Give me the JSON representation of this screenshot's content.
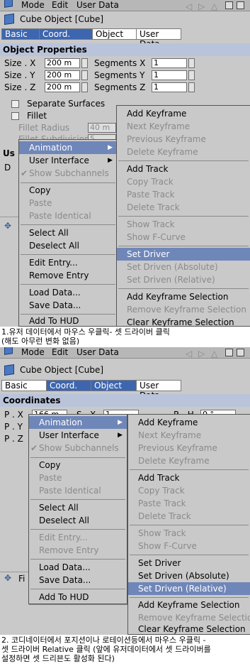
{
  "screen1": {
    "topbar": {
      "mode": "Mode",
      "edit": "Edit",
      "userdata": "User Data"
    },
    "object_title": "Cube Object [Cube]",
    "tabs": [
      {
        "label": "Basic",
        "selected": true
      },
      {
        "label": "Coord.",
        "selected": true
      },
      {
        "label": "Object",
        "selected": false
      },
      {
        "label": "User Data",
        "selected": false
      }
    ],
    "section_title": "Object Properties",
    "size_x_label": "Size . X",
    "size_y_label": "Size . Y",
    "size_z_label": "Size . Z",
    "size_x_value": "200 m",
    "size_y_value": "200 m",
    "size_z_value": "200 m",
    "seg_x_label": "Segments X",
    "seg_y_label": "Segments Y",
    "seg_z_label": "Segments Z",
    "seg_x_value": "1",
    "seg_y_value": "1",
    "seg_z_value": "1",
    "separate_surfaces": "Separate Surfaces",
    "fillet": "Fillet",
    "fillet_radius": "Fillet Radius",
    "fillet_radius_value": "40 m",
    "fillet_subdiv": "Fillet Subdivision",
    "fillet_subdiv_value": "5",
    "us_partial": "Us",
    "d_partial": "D",
    "context_menu": {
      "animation": "Animation",
      "user_interface": "User Interface",
      "show_subchannels": "Show Subchannels",
      "copy": "Copy",
      "paste": "Paste",
      "paste_identical": "Paste Identical",
      "select_all": "Select All",
      "deselect_all": "Deselect All",
      "edit_entry": "Edit Entry...",
      "remove_entry": "Remove Entry",
      "load_data": "Load Data...",
      "save_data": "Save Data...",
      "add_to_hud": "Add To HUD"
    },
    "submenu": {
      "add_keyframe": "Add Keyframe",
      "next_keyframe": "Next Keyframe",
      "previous_keyframe": "Previous Keyframe",
      "delete_keyframe": "Delete Keyframe",
      "add_track": "Add Track",
      "copy_track": "Copy Track",
      "paste_track": "Paste Track",
      "delete_track": "Delete Track",
      "show_track": "Show Track",
      "show_fcurve": "Show F-Curve",
      "set_driver": "Set Driver",
      "set_driven_absolute": "Set Driven (Absolute)",
      "set_driven_relative": "Set Driven (Relative)",
      "add_keyframe_selection": "Add Keyframe Selection",
      "remove_keyframe_selection": "Remove Keyframe Selection",
      "clear_keyframe_selection": "Clear Keyframe Selection"
    }
  },
  "caption1": {
    "line1": "1.유저 데이터에서  마우스 우클릭- 셋 드라이버 클릭",
    "line2": "(해도 아무런 변화 없음)"
  },
  "screen2": {
    "topbar": {
      "mode": "Mode",
      "edit": "Edit",
      "userdata": "User Data"
    },
    "object_title": "Cube Object [Cube]",
    "tabs": [
      {
        "label": "Basic",
        "selected": false
      },
      {
        "label": "Coord.",
        "selected": true
      },
      {
        "label": "Object",
        "selected": true
      },
      {
        "label": "User Data",
        "selected": false
      }
    ],
    "section_title": "Coordinates",
    "p_x_label": "P . X",
    "p_x_value": "166 m",
    "p_y_label": "P . Y",
    "p_z_label": "P . Z",
    "s_x_label": "S . X",
    "s_x_value": "1",
    "r_h_label": "R . H",
    "r_h_value": "0 °",
    "fi_partial": "Fi",
    "context_menu": {
      "animation": "Animation",
      "user_interface": "User Interface",
      "show_subchannels": "Show Subchannels",
      "copy": "Copy",
      "paste": "Paste",
      "paste_identical": "Paste Identical",
      "select_all": "Select All",
      "deselect_all": "Deselect All",
      "edit_entry": "Edit Entry...",
      "remove_entry": "Remove Entry",
      "load_data": "Load Data...",
      "save_data": "Save Data...",
      "add_to_hud": "Add To HUD"
    },
    "submenu": {
      "add_keyframe": "Add Keyframe",
      "next_keyframe": "Next Keyframe",
      "previous_keyframe": "Previous Keyframe",
      "delete_keyframe": "Delete Keyframe",
      "add_track": "Add Track",
      "copy_track": "Copy Track",
      "paste_track": "Paste Track",
      "delete_track": "Delete Track",
      "show_track": "Show Track",
      "show_fcurve": "Show F-Curve",
      "set_driver": "Set Driver",
      "set_driven_absolute": "Set Driven (Absolute)",
      "set_driven_relative": "Set Driven (Relative)",
      "add_keyframe_selection": "Add Keyframe Selection",
      "remove_keyframe_selection": "Remove Keyframe Selection",
      "clear_keyframe_selection": "Clear Keyframe Selection"
    }
  },
  "caption2": {
    "line1": "2. 코디네이터에서 포지션이나 로테이션등에서 마우스 우클릭 -",
    "line2": "셋 드라이버 Relative 클릭 (앞에 유저데이터에서 셋 드라이버를",
    "line3": "설정하면 셋 드리븐도 활성화 된다)"
  }
}
